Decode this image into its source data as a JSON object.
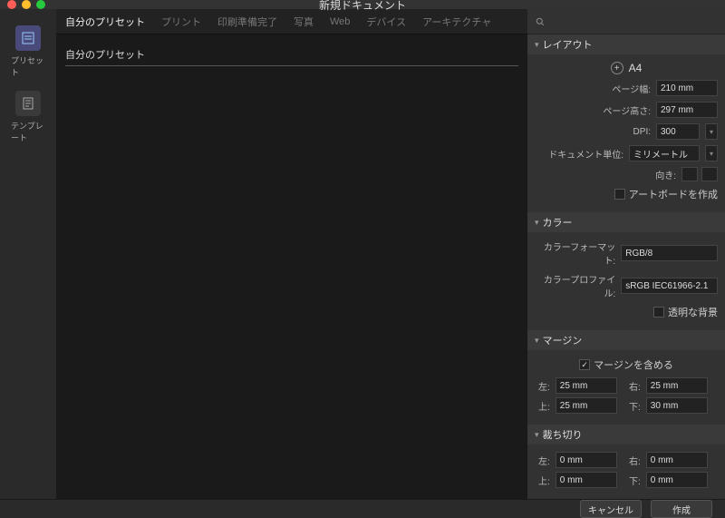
{
  "title": "新規ドキュメント",
  "leftbar": {
    "preset": "プリセット",
    "template": "テンプレート"
  },
  "tabs": [
    "自分のプリセット",
    "プリント",
    "印刷準備完了",
    "写真",
    "Web",
    "デバイス",
    "アーキテクチャ"
  ],
  "active_tab": 0,
  "section_heading": "自分のプリセット",
  "panels": {
    "layout": {
      "title": "レイアウト",
      "preset_name": "A4",
      "page_width_label": "ページ幅:",
      "page_width": "210 mm",
      "page_height_label": "ページ高さ:",
      "page_height": "297 mm",
      "dpi_label": "DPI:",
      "dpi": "300",
      "unit_label": "ドキュメント単位:",
      "unit": "ミリメートル",
      "orient_label": "向き:",
      "artboard_label": "アートボードを作成"
    },
    "color": {
      "title": "カラー",
      "format_label": "カラーフォーマット:",
      "format": "RGB/8",
      "profile_label": "カラープロファイル:",
      "profile": "sRGB IEC61966-2.1",
      "transparent_label": "透明な背景"
    },
    "margin": {
      "title": "マージン",
      "include_label": "マージンを含める",
      "include_checked": true,
      "left_l": "左:",
      "left": "25 mm",
      "right_l": "右:",
      "right": "25 mm",
      "top_l": "上:",
      "top": "25 mm",
      "bottom_l": "下:",
      "bottom": "30 mm"
    },
    "bleed": {
      "title": "裁ち切り",
      "left_l": "左:",
      "left": "0 mm",
      "right_l": "右:",
      "right": "0 mm",
      "top_l": "上:",
      "top": "0 mm",
      "bottom_l": "下:",
      "bottom": "0 mm"
    }
  },
  "footer": {
    "cancel": "キャンセル",
    "create": "作成"
  }
}
